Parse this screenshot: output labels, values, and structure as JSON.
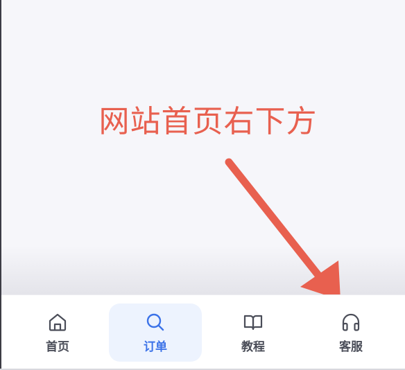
{
  "annotation": {
    "text": "网站首页右下方",
    "color": "#e8604f"
  },
  "tabbar": {
    "tabs": [
      {
        "label": "首页",
        "icon": "home-icon",
        "active": false
      },
      {
        "label": "订单",
        "icon": "search-icon",
        "active": true
      },
      {
        "label": "教程",
        "icon": "book-open-icon",
        "active": false
      },
      {
        "label": "客服",
        "icon": "headphones-icon",
        "active": false
      }
    ],
    "active_color": "#3b72e8",
    "inactive_color": "#4a4d58",
    "active_bg": "#edf3fe"
  }
}
